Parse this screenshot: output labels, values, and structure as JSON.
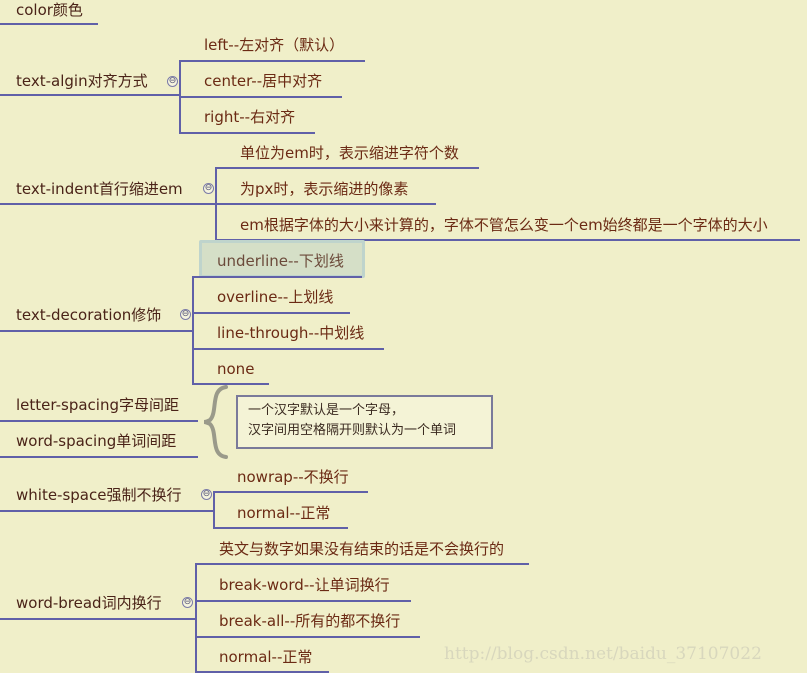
{
  "nodes": {
    "color": "color颜色",
    "text_align": {
      "label": "text-algin对齐方式",
      "children": [
        "left--左对齐（默认）",
        "center--居中对齐",
        "right--右对齐"
      ]
    },
    "text_indent": {
      "label": "text-indent首行缩进em",
      "children": [
        "单位为em时，表示缩进字符个数",
        "为px时，表示缩进的像素",
        "em根据字体的大小来计算的，字体不管怎么变一个em始终都是一个字体的大小"
      ]
    },
    "text_decoration": {
      "label": "text-decoration修饰",
      "children": [
        "underline--下划线",
        "overline--上划线",
        "line-through--中划线",
        "none"
      ]
    },
    "letter_spacing": "letter-spacing字母间距",
    "word_spacing": "word-spacing单词间距",
    "spacing_note": [
      "一个汉字默认是一个字母，",
      "汉字间用空格隔开则默认为一个单词"
    ],
    "white_space": {
      "label": "white-space强制不换行",
      "children": [
        "nowrap--不换行",
        "normal--正常"
      ]
    },
    "word_break": {
      "label": "word-bread词内换行",
      "children": [
        "英文与数字如果没有结束的话是不会换行的",
        "break-word--让单词换行",
        "break-all--所有的都不换行",
        "normal--正常"
      ]
    }
  },
  "collapse_symbol": "⊖",
  "watermark": "http://blog.csdn.net/baidu_37107022",
  "colors": {
    "background": "#f0efc9",
    "connector": "#6060a8",
    "text": "#6b2a14",
    "selected_fill": "#d5dfc7"
  }
}
